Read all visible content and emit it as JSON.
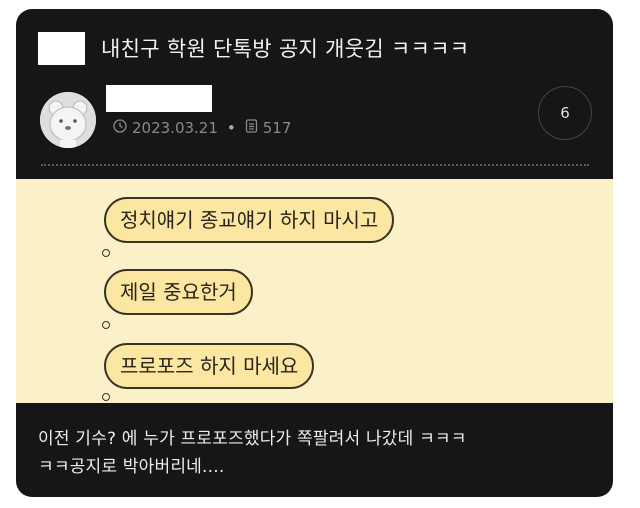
{
  "post": {
    "title": "내친구 학원 단톡방 공지 개웃김 ㅋㅋㅋㅋ",
    "date": "2023.03.21",
    "views": "517",
    "comment_count": "6"
  },
  "chat": {
    "messages": [
      "정치얘기 종교얘기 하지 마시고",
      "제일 중요한거",
      "프로포즈 하지 마세요"
    ]
  },
  "caption": {
    "line1": "이전 기수? 에 누가 프로포즈했다가 쪽팔려서 나갔데 ㅋㅋㅋ",
    "line2": "ㅋㅋ공지로 박아버리네...."
  },
  "icons": {
    "clock": "clock-icon",
    "views": "document-icon",
    "avatar": "bear-avatar"
  },
  "colors": {
    "card_bg": "#161616",
    "chat_bg": "#fbf1c8",
    "bubble_bg": "#fbe7a1"
  }
}
